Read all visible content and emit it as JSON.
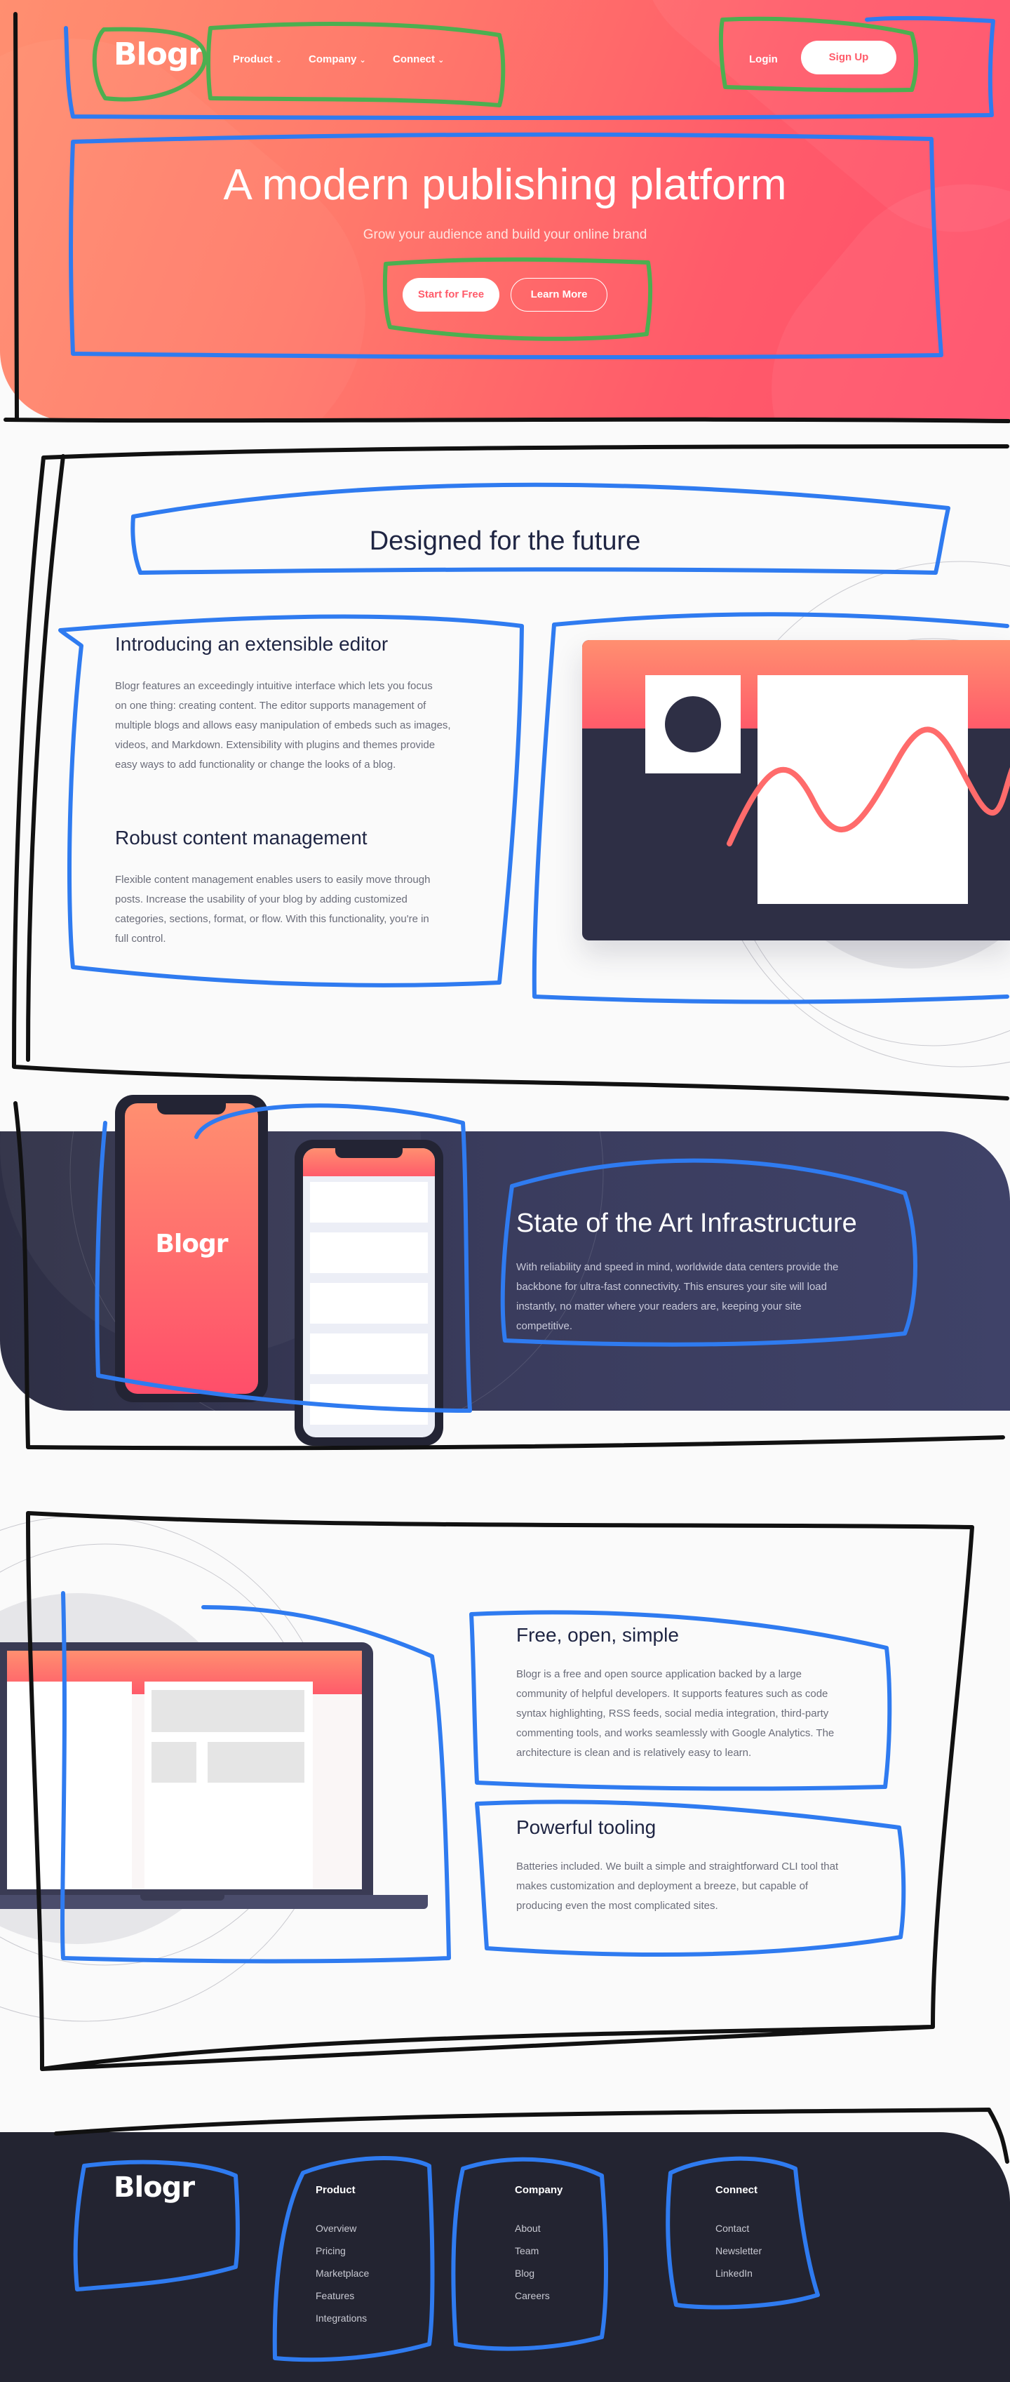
{
  "brand": {
    "logo": "Blogr"
  },
  "nav": {
    "items": [
      {
        "label": "Product"
      },
      {
        "label": "Company"
      },
      {
        "label": "Connect"
      }
    ],
    "login": "Login",
    "signup": "Sign Up"
  },
  "hero": {
    "title": "A modern publishing platform",
    "subtitle": "Grow your audience and build your online brand",
    "primary_cta": "Start for Free",
    "secondary_cta": "Learn More"
  },
  "future": {
    "title": "Designed for the future",
    "features": [
      {
        "heading": "Introducing an extensible editor",
        "lines": [
          "Blogr features an exceedingly intuitive interface which lets you focus",
          "on one thing: creating content. The editor supports management of",
          "multiple blogs and allows easy manipulation of embeds such as images,",
          "videos, and Markdown. Extensibility with plugins and themes provide",
          "easy ways to add functionality or change the looks of a blog."
        ]
      },
      {
        "heading": "Robust content management",
        "lines": [
          "Flexible content management enables users to easily move through",
          "posts. Increase the usability of your blog by adding customized",
          "categories, sections, format, or flow. With this functionality, you're in",
          "full control."
        ]
      }
    ]
  },
  "infrastructure": {
    "phone_logo": "Blogr",
    "heading": "State of the Art Infrastructure",
    "lines": [
      "With reliability and speed in mind, worldwide data centers provide the",
      "backbone for ultra-fast connectivity. This ensures your site will load",
      "instantly, no matter where your readers are, keeping your site",
      "competitive."
    ]
  },
  "more_features": [
    {
      "heading": "Free, open, simple",
      "lines": [
        "Blogr is a free and open source application backed by a large",
        "community of helpful developers. It supports features such as code",
        "syntax highlighting, RSS feeds, social media integration, third-party",
        "commenting tools, and works seamlessly with Google Analytics. The",
        "architecture is clean and is relatively easy to learn."
      ]
    },
    {
      "heading": "Powerful tooling",
      "lines": [
        "Batteries included. We built a simple and straightforward CLI tool that",
        "makes customization and deployment a breeze, but capable of",
        "producing even the most complicated sites."
      ]
    }
  ],
  "footer": {
    "logo": "Blogr",
    "columns": [
      {
        "title": "Product",
        "links": [
          "Overview",
          "Pricing",
          "Marketplace",
          "Features",
          "Integrations"
        ]
      },
      {
        "title": "Company",
        "links": [
          "About",
          "Team",
          "Blog",
          "Careers"
        ]
      },
      {
        "title": "Connect",
        "links": [
          "Contact",
          "Newsletter",
          "LinkedIn"
        ]
      }
    ]
  },
  "colors": {
    "hero_gradient_start": "#ff8f70",
    "hero_gradient_end": "#ff4e6a",
    "dark_navy": "#1f2543",
    "band_dark": "#2e2f45",
    "footer_bg": "#232431",
    "annotation_blue": "#2f7bf0",
    "annotation_green": "#4caf50",
    "annotation_black": "#111111"
  }
}
